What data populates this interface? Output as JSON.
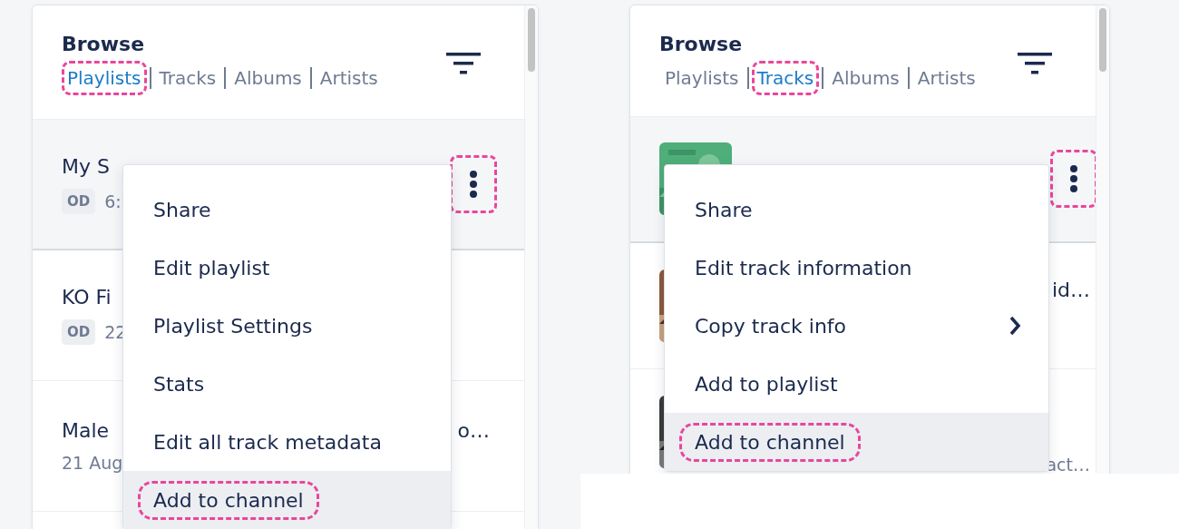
{
  "panels": [
    {
      "title": "Browse",
      "tabs": [
        {
          "label": "Playlists",
          "selected": true,
          "highlighted": true
        },
        {
          "label": "Tracks",
          "selected": false,
          "highlighted": false
        },
        {
          "label": "Albums",
          "selected": false,
          "highlighted": false
        },
        {
          "label": "Artists",
          "selected": false,
          "highlighted": false
        }
      ],
      "rows": [
        {
          "kind": "playlist",
          "selected": true,
          "title": "My S",
          "badge": "OD",
          "meta": "6:",
          "more_button": {
            "highlighted": true
          }
        },
        {
          "kind": "playlist",
          "selected": false,
          "title": "KO Fi",
          "badge": "OD",
          "meta": "22"
        },
        {
          "kind": "playlist",
          "selected": false,
          "title": "Male",
          "meta": "21 Aug",
          "trailing": {
            "kind": "title",
            "text": "o…"
          }
        }
      ],
      "menu": {
        "items": [
          {
            "label": "Share",
            "hovered": false,
            "highlighted": false,
            "submenu": false
          },
          {
            "label": "Edit playlist",
            "hovered": false,
            "highlighted": false,
            "submenu": false
          },
          {
            "label": "Playlist Settings",
            "hovered": false,
            "highlighted": false,
            "submenu": false
          },
          {
            "label": "Stats",
            "hovered": false,
            "highlighted": false,
            "submenu": false
          },
          {
            "label": "Edit all track metadata",
            "hovered": false,
            "highlighted": false,
            "submenu": false
          },
          {
            "label": "Add to channel",
            "hovered": true,
            "highlighted": true,
            "submenu": false
          }
        ]
      }
    },
    {
      "title": "Browse",
      "tabs": [
        {
          "label": "Playlists",
          "selected": false,
          "highlighted": false
        },
        {
          "label": "Tracks",
          "selected": true,
          "highlighted": true
        },
        {
          "label": "Albums",
          "selected": false,
          "highlighted": false
        },
        {
          "label": "Artists",
          "selected": false,
          "highlighted": false
        }
      ],
      "rows": [
        {
          "kind": "track",
          "selected": true,
          "more_button": {
            "highlighted": true
          }
        },
        {
          "kind": "track",
          "selected": false,
          "trailing": {
            "kind": "title",
            "text": "id…"
          }
        },
        {
          "kind": "track",
          "selected": false,
          "trailing": {
            "kind": "meta",
            "text": "act…"
          }
        }
      ],
      "menu": {
        "items": [
          {
            "label": "Share",
            "hovered": false,
            "highlighted": false,
            "submenu": false
          },
          {
            "label": "Edit track information",
            "hovered": false,
            "highlighted": false,
            "submenu": false
          },
          {
            "label": "Copy track info",
            "hovered": false,
            "highlighted": false,
            "submenu": true
          },
          {
            "label": "Add to playlist",
            "hovered": false,
            "highlighted": false,
            "submenu": false
          },
          {
            "label": "Add to channel",
            "hovered": true,
            "highlighted": true,
            "submenu": false
          }
        ]
      }
    }
  ]
}
